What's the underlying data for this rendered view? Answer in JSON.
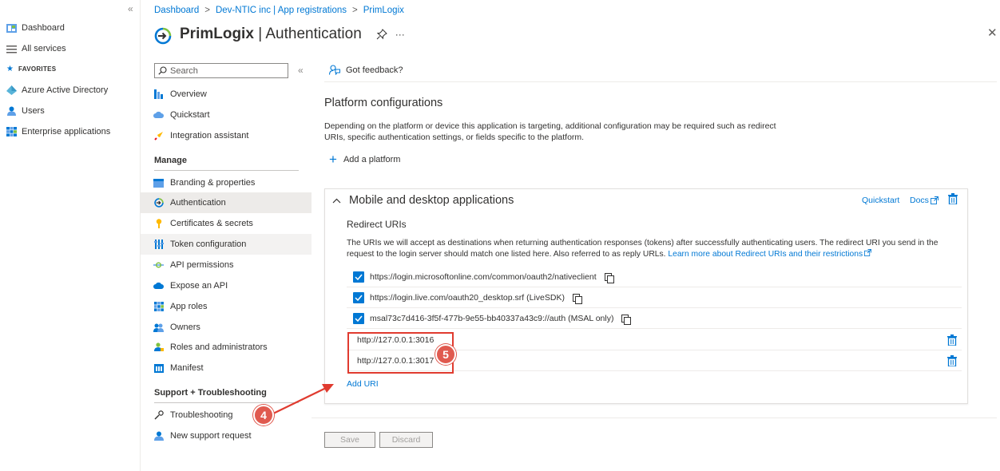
{
  "leftnav": {
    "collapse_icon": "«",
    "dashboard": "Dashboard",
    "all_services": "All services",
    "favorites": "FAVORITES",
    "azure_ad": "Azure Active Directory",
    "users": "Users",
    "enterprise_apps": "Enterprise applications"
  },
  "breadcrumb": {
    "item1": "Dashboard",
    "item2": "Dev-NTIC inc | App registrations",
    "item3": "PrimLogix",
    "separator": ">"
  },
  "header": {
    "title_bold": "PrimLogix",
    "title_rest": "| Authentication",
    "more": "···",
    "close": "✕"
  },
  "menu": {
    "search_placeholder": "Search",
    "collapse_icon": "«",
    "overview": "Overview",
    "quickstart": "Quickstart",
    "integration_assistant": "Integration assistant",
    "manage_section": "Manage",
    "branding": "Branding & properties",
    "authentication": "Authentication",
    "certificates": "Certificates & secrets",
    "token_config": "Token configuration",
    "api_permissions": "API permissions",
    "expose_api": "Expose an API",
    "app_roles": "App roles",
    "owners": "Owners",
    "roles_admins": "Roles and administrators",
    "manifest": "Manifest",
    "support_section": "Support + Troubleshooting",
    "troubleshooting": "Troubleshooting",
    "new_support": "New support request"
  },
  "main": {
    "feedback": "Got feedback?",
    "platform_title": "Platform configurations",
    "platform_desc": "Depending on the platform or device this application is targeting, additional configuration may be required such as redirect URIs, specific authentication settings, or fields specific to the platform.",
    "add_platform": "Add a platform",
    "card_title": "Mobile and desktop applications",
    "quickstart": "Quickstart",
    "docs": "Docs",
    "redirect_title": "Redirect URIs",
    "redirect_desc": "The URIs we will accept as destinations when returning authentication responses (tokens) after successfully authenticating users. The redirect URI you send in the request to the login server should match one listed here. Also referred to as reply URLs. ",
    "redirect_link": "Learn more about Redirect URIs and their restrictions",
    "uris_checked": [
      "https://login.microsoftonline.com/common/oauth2/nativeclient",
      "https://login.live.com/oauth20_desktop.srf (LiveSDK)",
      "msal73c7d416-3f5f-477b-9e55-bb40337a43c9://auth (MSAL only)"
    ],
    "uris_custom": [
      "http://127.0.0.1:3016",
      "http://127.0.0.1:3017"
    ],
    "add_uri": "Add URI",
    "save": "Save",
    "discard": "Discard"
  },
  "annotations": {
    "step4": "4",
    "step5": "5"
  },
  "colors": {
    "accent": "#0078d4",
    "annotation_red": "#e03b2f",
    "active_bg": "#edebe9"
  }
}
